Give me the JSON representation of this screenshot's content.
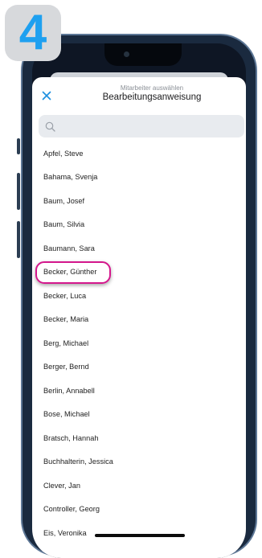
{
  "step": {
    "number": "4",
    "color": "#1ea0f0",
    "badge_bg": "#d7d9dc"
  },
  "header": {
    "close_icon": "close-icon",
    "subtitle": "Mitarbeiter auswählen",
    "title": "Bearbeitungsanweisung"
  },
  "search": {
    "icon": "search-icon",
    "placeholder": "",
    "value": ""
  },
  "employees": [
    "Apfel, Steve",
    "Bahama, Svenja",
    "Baum, Josef",
    "Baum, Silvia",
    "Baumann, Sara",
    "Becker, Günther",
    "Becker, Luca",
    "Becker, Maria",
    "Berg, Michael",
    "Berger, Bernd",
    "Berlin, Annabell",
    "Bose, Michael",
    "Bratsch, Hannah",
    "Buchhalterin, Jessica",
    "Clever, Jan",
    "Controller, Georg",
    "Eis, Veronika"
  ],
  "highlighted_employee": "Becker, Günther",
  "colors": {
    "accent": "#1e90e0",
    "highlight": "#d4178c",
    "frame": "#1a2a3f"
  }
}
